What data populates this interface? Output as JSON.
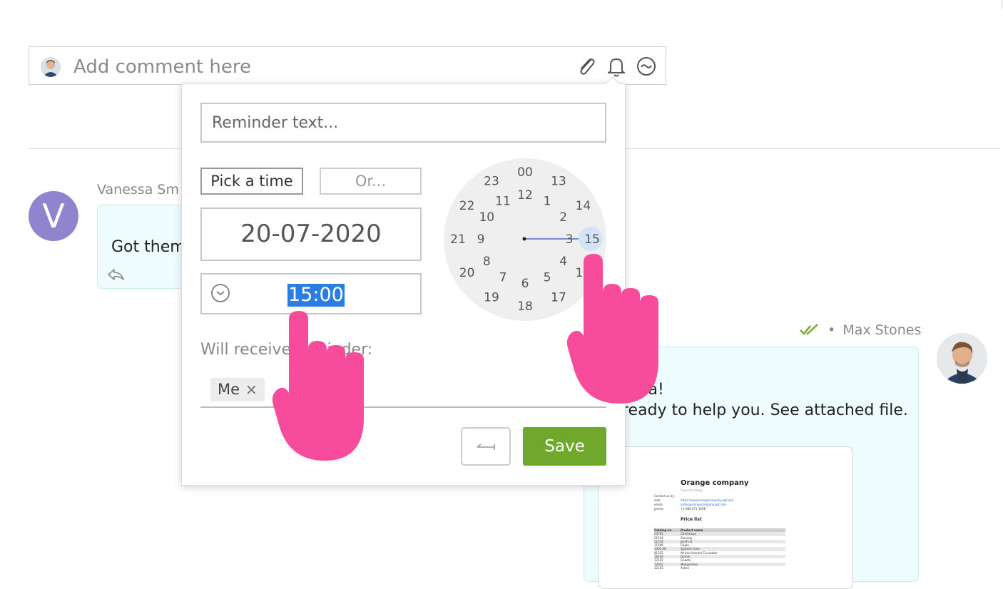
{
  "comment_bar": {
    "placeholder": "Add comment here",
    "icons": [
      "paperclip-icon",
      "bell-icon",
      "emoji-icon"
    ]
  },
  "messages": {
    "vanessa": {
      "avatar_letter": "V",
      "author": "Vanessa Smith",
      "author_visible": "Vanessa Sm",
      "text": "Got them"
    },
    "max": {
      "author": "Max Stones",
      "separator": "•",
      "line1": "essa!",
      "line2": "ready to help you. See attached file."
    }
  },
  "attachment": {
    "company": "Orange company",
    "tagline": "Fruits for happy",
    "contact_labels": [
      "Contact us by:",
      "web:",
      "email:",
      "phone:"
    ],
    "contact_values": [
      "https://www.orangecompany.ugf.com",
      "order@orangecompany.ugf.com",
      "+1 888 971 1698"
    ],
    "price_list_title": "Price list",
    "table_headers": [
      "Catalog no.",
      "Product name"
    ],
    "table_rows": [
      [
        "23701",
        "Cherimoya"
      ],
      [
        "21514",
        "Soursop"
      ],
      [
        "21574",
        "Jackfruit"
      ],
      [
        "11589",
        "Feijoa"
      ],
      [
        "1301-X8",
        "Spanish Lime"
      ],
      [
        "81322",
        "African Horned Cucumber"
      ],
      [
        "16102",
        "Durian"
      ],
      [
        "12102",
        "Gnaeta"
      ],
      [
        "12602",
        "Mangosteen"
      ],
      [
        "12103",
        "Ackee"
      ]
    ]
  },
  "reminder": {
    "text_placeholder": "Reminder text...",
    "pick_time_label": "Pick a time",
    "or_label": "Or...",
    "date": "20-07-2020",
    "time": "15:00",
    "receivers_label": "Will receive reminder:",
    "receivers": [
      "Me"
    ],
    "remove_glyph": "×",
    "save_label": "Save",
    "back_glyph": "↤"
  },
  "clock": {
    "selected_hour": "15",
    "inner_numbers": [
      "12",
      "1",
      "2",
      "3",
      "4",
      "5",
      "6",
      "7",
      "8",
      "9",
      "10",
      "11"
    ],
    "outer_numbers": [
      "00",
      "13",
      "14",
      "15",
      "16",
      "17",
      "18",
      "19",
      "20",
      "21",
      "22",
      "23"
    ]
  },
  "colors": {
    "accent_blue": "#2a7de1",
    "save_green": "#6fa82c",
    "avatar_purple": "#9184cf",
    "hand_pink": "#f74b9b",
    "read_check_green": "#6fa82c",
    "bubble_bg": "#effcfd"
  }
}
